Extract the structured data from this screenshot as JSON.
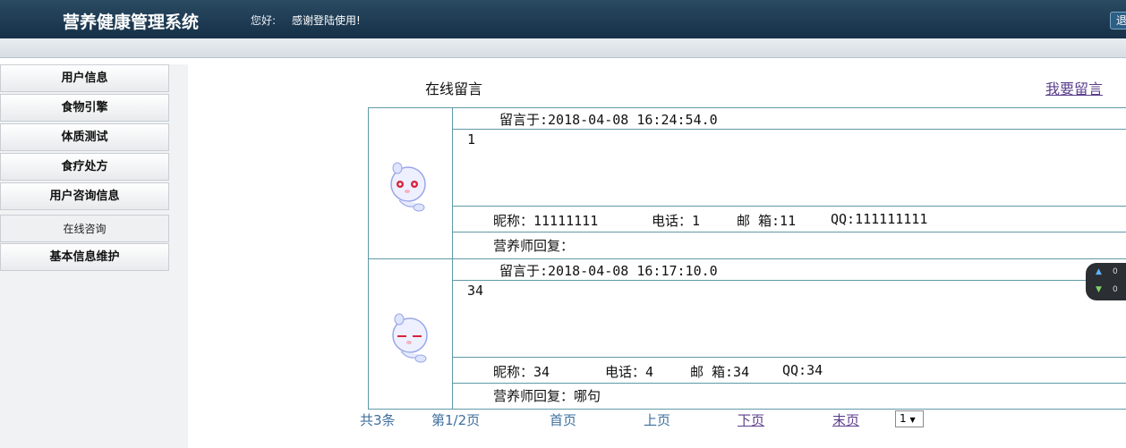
{
  "header": {
    "app_title": "营养健康管理系统",
    "greeting": "您好:",
    "welcome": "感谢登陆使用!",
    "logout_label": "退"
  },
  "sidebar": {
    "items": [
      {
        "label": "用户信息"
      },
      {
        "label": "食物引擎"
      },
      {
        "label": "体质测试"
      },
      {
        "label": "食疗处方"
      },
      {
        "label": "用户咨询信息"
      },
      {
        "label": "在线咨询"
      },
      {
        "label": "基本信息维护"
      }
    ]
  },
  "main": {
    "title": "在线留言",
    "leave_message_link": "我要留言",
    "messages": [
      {
        "posted_at": "留言于:2018-04-08 16:24:54.0",
        "content": "1",
        "nickname": "昵称：11111111",
        "phone": "电话：1",
        "email": "邮 箱:11",
        "qq": "QQ:111111111",
        "reply": "营养师回复："
      },
      {
        "posted_at": "留言于:2018-04-08 16:17:10.0",
        "content": "34",
        "nickname": "昵称：34",
        "phone": "电话：4",
        "email": "邮 箱:34",
        "qq": "QQ:34",
        "reply": "营养师回复：哪句"
      }
    ]
  },
  "pagination": {
    "total": "共3条",
    "page": "第1/2页",
    "first": "首页",
    "prev": "上页",
    "next": "下页",
    "last": "末页",
    "selected": "1"
  },
  "net_widget": {
    "up": "0",
    "down": "0"
  },
  "colors": {
    "header_bg": "#1d3a52",
    "table_border": "#5f9aa8",
    "pager_text": "#3d6f9e",
    "link_visited": "#5b3f8c"
  }
}
